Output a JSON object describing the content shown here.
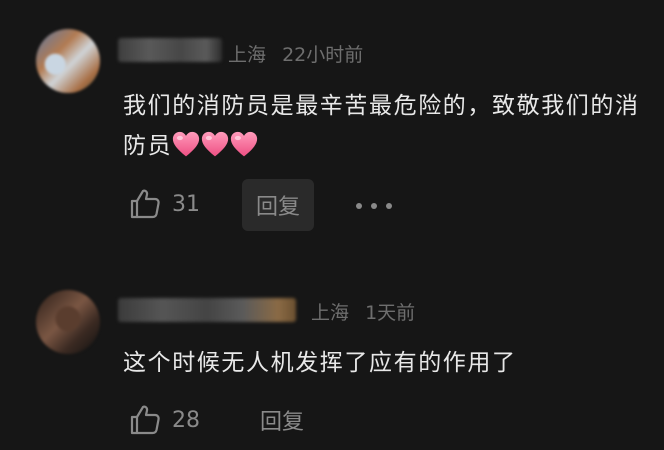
{
  "comments": [
    {
      "location": "上海",
      "time": "22小时前",
      "text": "我们的消防员是最辛苦最危险的，致敬我们的消防员",
      "emoji": "❤️❤️❤️",
      "likes": "31",
      "reply_label": "回复"
    },
    {
      "location": "上海",
      "time": "1天前",
      "text": "这个时候无人机发挥了应有的作用了",
      "likes": "28",
      "reply_label": "回复"
    }
  ],
  "colors": {
    "background": "#161616",
    "text": "#e8e8e8",
    "meta": "#6e6e6e",
    "action": "#8a8a8a",
    "heart": "#f26d9a"
  },
  "icons": [
    "thumbs-up-icon",
    "heart-icon",
    "more-dots-icon"
  ]
}
